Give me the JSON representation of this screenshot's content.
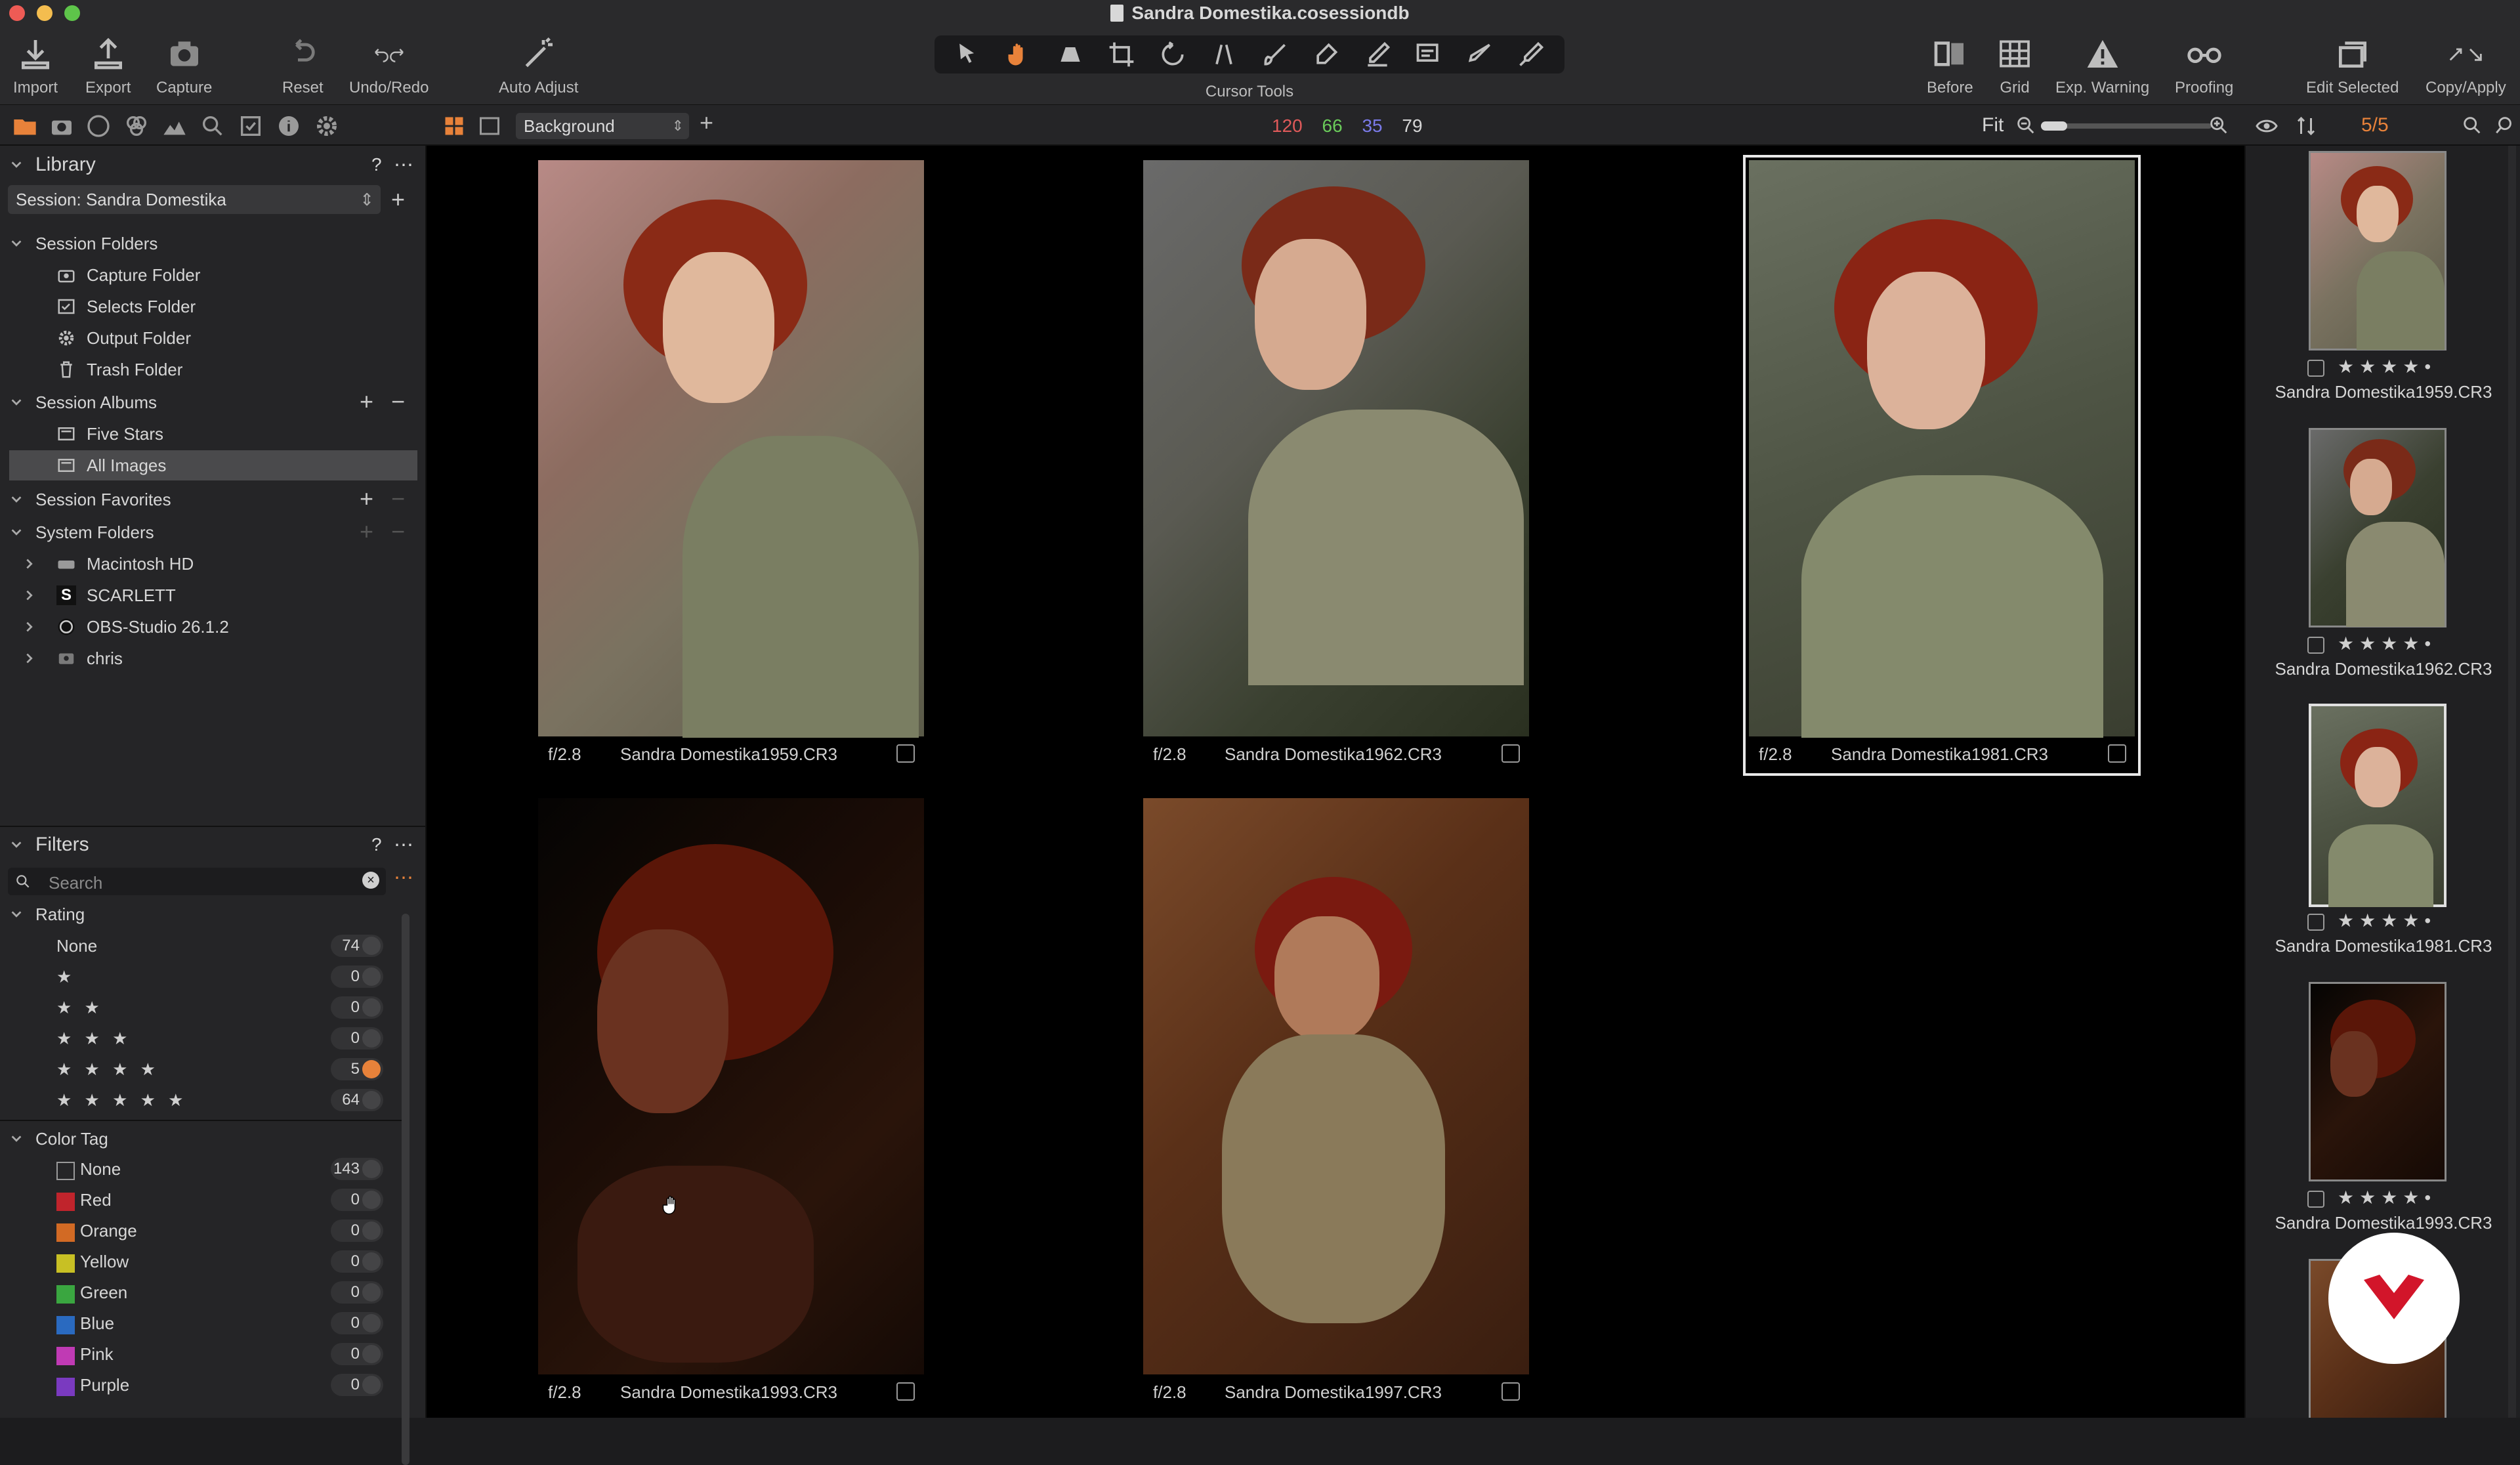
{
  "window": {
    "title": "Sandra Domestika.cosessiondb"
  },
  "toolbar": {
    "import": "Import",
    "export": "Export",
    "capture": "Capture",
    "reset": "Reset",
    "undo_redo": "Undo/Redo",
    "auto_adjust": "Auto Adjust",
    "cursor_tools": "Cursor Tools",
    "before": "Before",
    "grid": "Grid",
    "exp_warning": "Exp. Warning",
    "proofing": "Proofing",
    "edit_selected": "Edit Selected",
    "copy_apply": "Copy/Apply"
  },
  "subbar": {
    "layer": "Background",
    "counts": {
      "red": "120",
      "green": "66",
      "blue": "35",
      "total": "79"
    },
    "zoom": "Fit",
    "image_count": "5/5"
  },
  "library": {
    "title": "Library",
    "help": "?",
    "session": "Session: Sandra Domestika",
    "session_folders": "Session Folders",
    "folders": [
      "Capture Folder",
      "Selects Folder",
      "Output Folder",
      "Trash Folder"
    ],
    "session_albums": "Session Albums",
    "albums": [
      "Five Stars",
      "All Images"
    ],
    "session_favorites": "Session Favorites",
    "system_folders": "System Folders",
    "system": [
      "Macintosh HD",
      "SCARLETT",
      "OBS-Studio 26.1.2",
      "chris"
    ]
  },
  "filters": {
    "title": "Filters",
    "help": "?",
    "search_placeholder": "Search",
    "rating_label": "Rating",
    "ratings": [
      {
        "label": "None",
        "count": "74"
      },
      {
        "label": "★",
        "count": "0"
      },
      {
        "label": "★ ★",
        "count": "0"
      },
      {
        "label": "★ ★ ★",
        "count": "0"
      },
      {
        "label": "★ ★ ★ ★",
        "count": "5"
      },
      {
        "label": "★ ★ ★ ★ ★",
        "count": "64"
      }
    ],
    "color_tag_label": "Color Tag",
    "colors": [
      {
        "label": "None",
        "count": "143",
        "color": "#1c1c1e"
      },
      {
        "label": "Red",
        "count": "0",
        "color": "#c0242c"
      },
      {
        "label": "Orange",
        "count": "0",
        "color": "#d26a24"
      },
      {
        "label": "Yellow",
        "count": "0",
        "color": "#c8c024"
      },
      {
        "label": "Green",
        "count": "0",
        "color": "#3aa640"
      },
      {
        "label": "Blue",
        "count": "0",
        "color": "#2a6ac0"
      },
      {
        "label": "Pink",
        "count": "0",
        "color": "#c03ab4"
      },
      {
        "label": "Purple",
        "count": "0",
        "color": "#7a3ac0"
      }
    ]
  },
  "viewer": {
    "images": [
      {
        "aperture": "f/2.8",
        "name": "Sandra Domestika1959.CR3"
      },
      {
        "aperture": "f/2.8",
        "name": "Sandra Domestika1962.CR3"
      },
      {
        "aperture": "f/2.8",
        "name": "Sandra Domestika1981.CR3"
      },
      {
        "aperture": "f/2.8",
        "name": "Sandra Domestika1993.CR3"
      },
      {
        "aperture": "f/2.8",
        "name": "Sandra Domestika1997.CR3"
      }
    ]
  },
  "browser": {
    "thumbs": [
      {
        "name": "Sandra Domestika1959.CR3",
        "stars": "★★★★•"
      },
      {
        "name": "Sandra Domestika1962.CR3",
        "stars": "★★★★•"
      },
      {
        "name": "Sandra Domestika1981.CR3",
        "stars": "★★★★•"
      },
      {
        "name": "Sandra Domestika1993.CR3",
        "stars": "★★★★•"
      }
    ]
  },
  "colors": {
    "accent": "#e8823a",
    "red_count": "#e05a5a",
    "green_count": "#6acb5a",
    "blue_count": "#7a7ae8"
  }
}
